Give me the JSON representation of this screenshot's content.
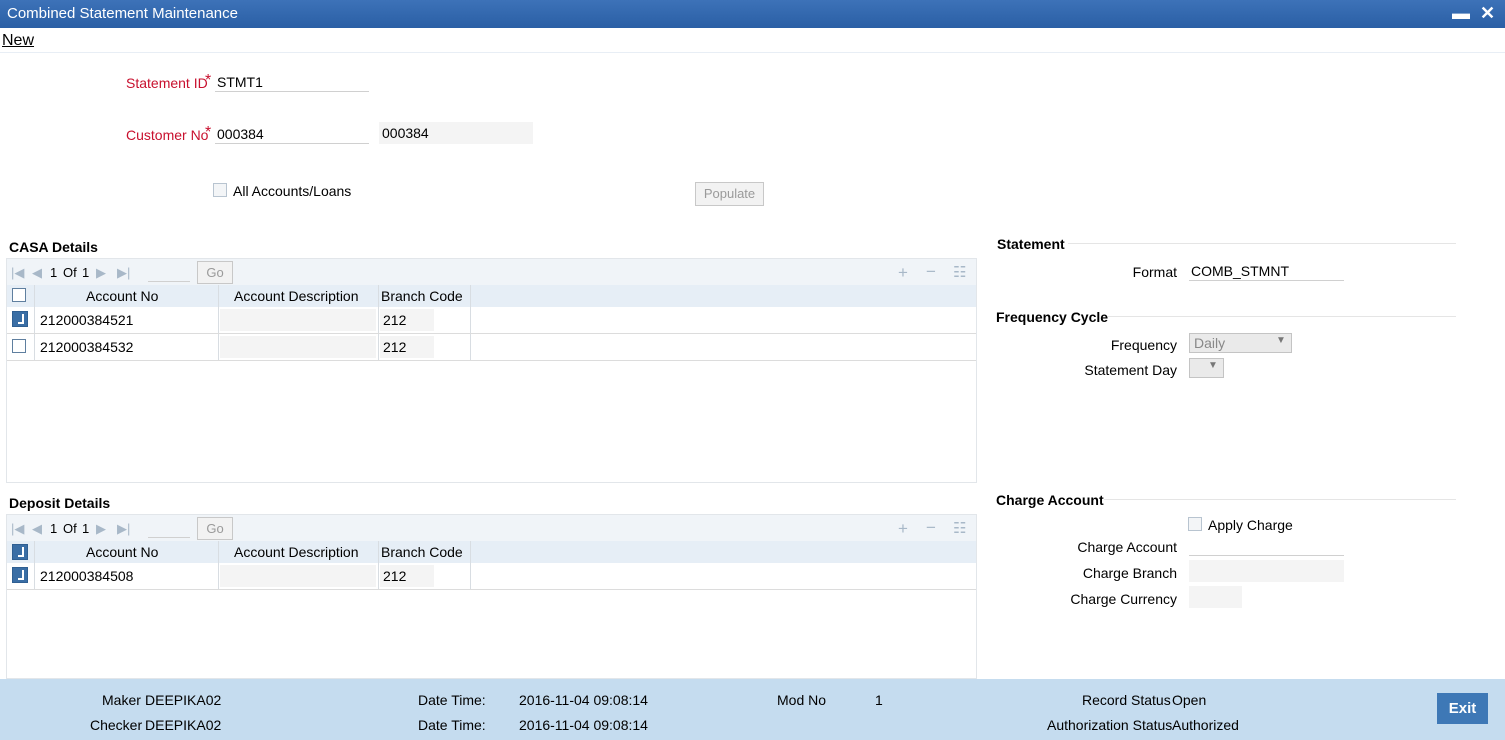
{
  "window": {
    "title": "Combined Statement Maintenance",
    "minimize": "▬",
    "close": "✕"
  },
  "menu": {
    "new_label": "New"
  },
  "form": {
    "statement_id_label": "Statement ID",
    "statement_id_value": "STMT1",
    "customer_no_label": "Customer No",
    "customer_no_value": "000384",
    "customer_desc_value": "000384",
    "required_mark": "*",
    "all_accounts_label": "All Accounts/Loans",
    "populate_label": "Populate"
  },
  "casa": {
    "title": "CASA Details",
    "page_current": "1",
    "page_of": "Of",
    "page_total": "1",
    "go_label": "Go",
    "columns": [
      "Account No",
      "Account Description",
      "Branch Code"
    ],
    "rows": [
      {
        "checked": true,
        "account_no": "212000384521",
        "description": "",
        "branch_code": "212"
      },
      {
        "checked": false,
        "account_no": "212000384532",
        "description": "",
        "branch_code": "212"
      }
    ]
  },
  "deposit": {
    "title": "Deposit Details",
    "page_current": "1",
    "page_of": "Of",
    "page_total": "1",
    "go_label": "Go",
    "columns": [
      "Account No",
      "Account Description",
      "Branch Code"
    ],
    "rows": [
      {
        "checked": true,
        "account_no": "212000384508",
        "description": "",
        "branch_code": "212"
      }
    ]
  },
  "statement": {
    "title": "Statement",
    "format_label": "Format",
    "format_value": "COMB_STMNT"
  },
  "frequency": {
    "title": "Frequency Cycle",
    "frequency_label": "Frequency",
    "frequency_value": "Daily",
    "statement_day_label": "Statement Day",
    "statement_day_value": ""
  },
  "charge": {
    "title": "Charge Account",
    "apply_charge_label": "Apply Charge",
    "charge_account_label": "Charge Account",
    "charge_branch_label": "Charge Branch",
    "charge_currency_label": "Charge Currency"
  },
  "footer": {
    "maker_label": "Maker",
    "maker_value": "DEEPIKA02",
    "checker_label": "Checker",
    "checker_value": "DEEPIKA02",
    "datetime_label": "Date Time:",
    "maker_datetime": "2016-11-04 09:08:14",
    "checker_datetime": "2016-11-04 09:08:14",
    "mod_no_label": "Mod No",
    "mod_no_value": "1",
    "record_status_label": "Record Status",
    "record_status_value": "Open",
    "auth_status_label": "Authorization Status",
    "auth_status_value": "Authorized",
    "exit_label": "Exit"
  },
  "colors": {
    "titlebar": "#2a5fa5",
    "footer": "#c5dcef",
    "required": "#c8102e",
    "exit_button": "#3e78b6",
    "checkbox_checked": "#3a6ea5"
  },
  "icons": [
    "first-page-icon",
    "prev-page-icon",
    "next-page-icon",
    "last-page-icon",
    "add-row-icon",
    "delete-row-icon",
    "single-view-icon",
    "dropdown-arrow-icon"
  ]
}
